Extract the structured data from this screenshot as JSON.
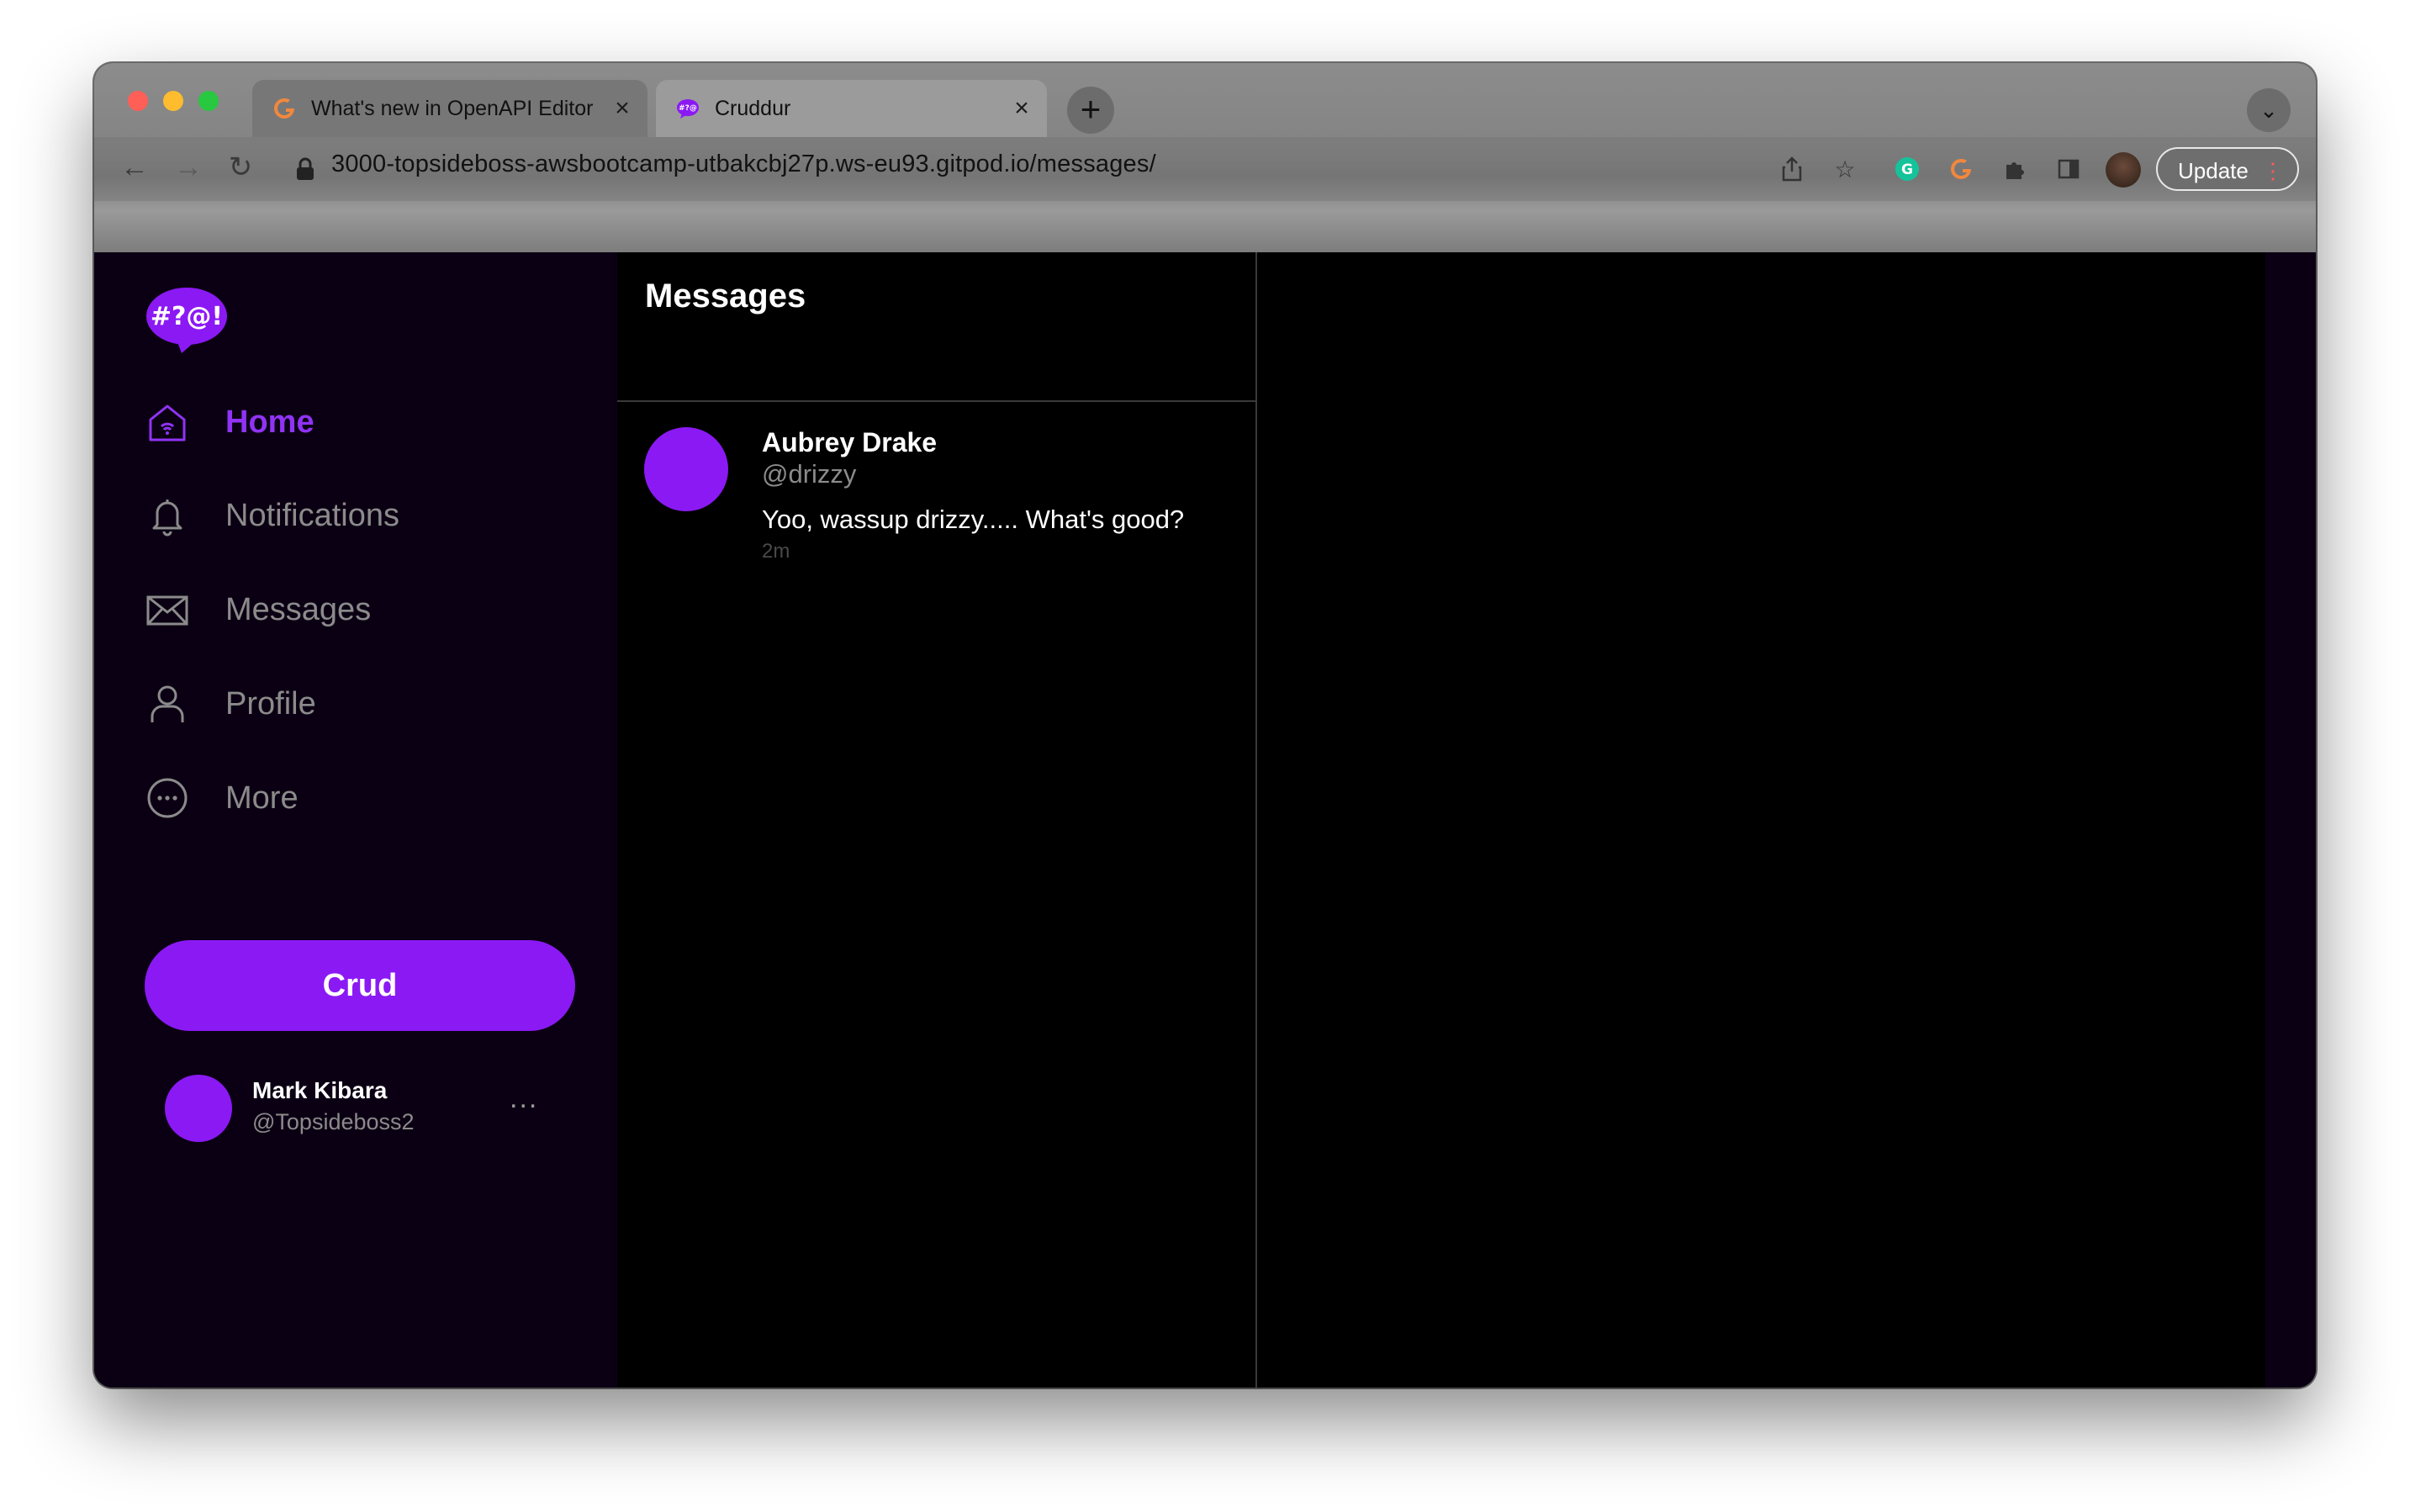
{
  "browser": {
    "tabs": [
      {
        "title": "What's new in OpenAPI Editor",
        "active": false
      },
      {
        "title": "Cruddur",
        "active": true
      }
    ],
    "url": "3000-topsideboss-awsbootcamp-utbakcbj27p.ws-eu93.gitpod.io/messages/",
    "update_label": "Update"
  },
  "sidebar": {
    "logo_text": "#?@!",
    "nav": [
      {
        "label": "Home",
        "icon": "home-icon",
        "active": true
      },
      {
        "label": "Notifications",
        "icon": "bell-icon",
        "active": false
      },
      {
        "label": "Messages",
        "icon": "envelope-icon",
        "active": false
      },
      {
        "label": "Profile",
        "icon": "user-icon",
        "active": false
      },
      {
        "label": "More",
        "icon": "more-circle-icon",
        "active": false
      }
    ],
    "crud_label": "Crud",
    "user": {
      "name": "Mark Kibara",
      "handle": "@Topsideboss2",
      "more": "..."
    }
  },
  "feed": {
    "title": "Messages",
    "messages": [
      {
        "name": "Aubrey Drake",
        "handle": "@drizzy",
        "text": "Yoo, wassup drizzy..... What's good?",
        "time": "2m"
      }
    ]
  },
  "colors": {
    "accent": "#8b19f4",
    "sidebar_bg": "#0b0013",
    "content_bg": "#000000"
  }
}
